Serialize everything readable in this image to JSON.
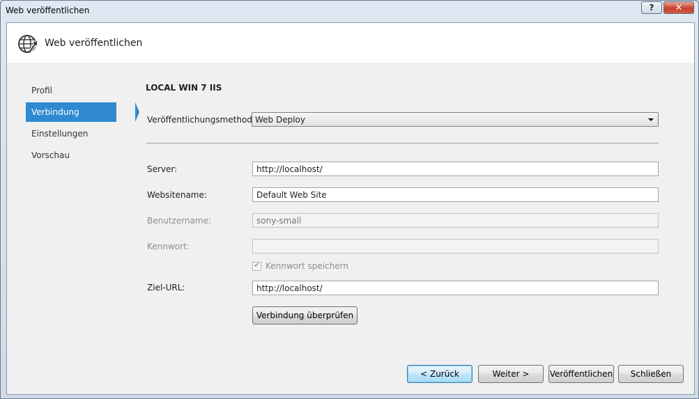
{
  "window": {
    "title": "Web veröffentlichen",
    "help_button": "?",
    "close_button": "✕"
  },
  "header": {
    "title": "Web veröffentlichen",
    "icon": "globe-arrow-icon"
  },
  "nav": {
    "items": [
      {
        "label": "Profil",
        "active": false
      },
      {
        "label": "Verbindung",
        "active": true
      },
      {
        "label": "Einstellungen",
        "active": false
      },
      {
        "label": "Vorschau",
        "active": false
      }
    ],
    "active_color": "#2f8ad1"
  },
  "connection": {
    "profile_name": "LOCAL WIN 7 IIS",
    "method": {
      "label": "Veröffentlichungsmethode:",
      "value": "Web Deploy"
    },
    "server": {
      "label": "Server:",
      "value": "http://localhost/"
    },
    "site_name": {
      "label": "Websitename:",
      "value": "Default Web Site"
    },
    "user_name": {
      "label": "Benutzername:",
      "placeholder": "sony-small",
      "disabled": true
    },
    "password": {
      "label": "Kennwort:",
      "value": "",
      "disabled": true
    },
    "save_password": {
      "label": "Kennwort speichern",
      "checked": true,
      "disabled": true
    },
    "target_url": {
      "label": "Ziel-URL:",
      "value": "http://localhost/"
    },
    "validate_button": "Verbindung überprüfen"
  },
  "footer": {
    "back_button": "< Zurück",
    "next_button": "Weiter >",
    "publish_button": "Veröffentlichen",
    "close_button": "Schließen"
  }
}
